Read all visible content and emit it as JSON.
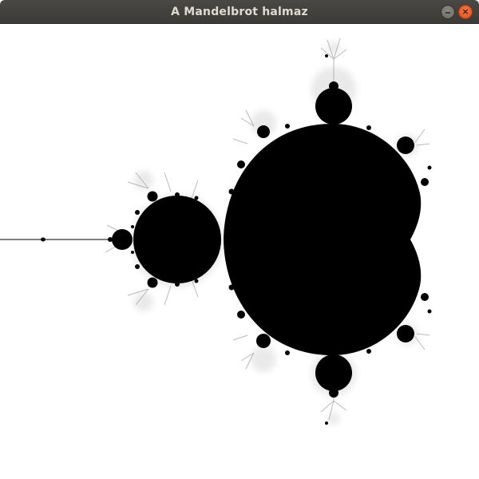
{
  "window": {
    "title": "A Mandelbrot halmaz",
    "controls": {
      "minimize_icon": "minimize-icon",
      "close_icon": "close-icon",
      "close_glyph": "×"
    }
  },
  "canvas": {
    "background": "#ffffff",
    "set_color": "#000000",
    "halo_color": "#bdbdbd"
  }
}
